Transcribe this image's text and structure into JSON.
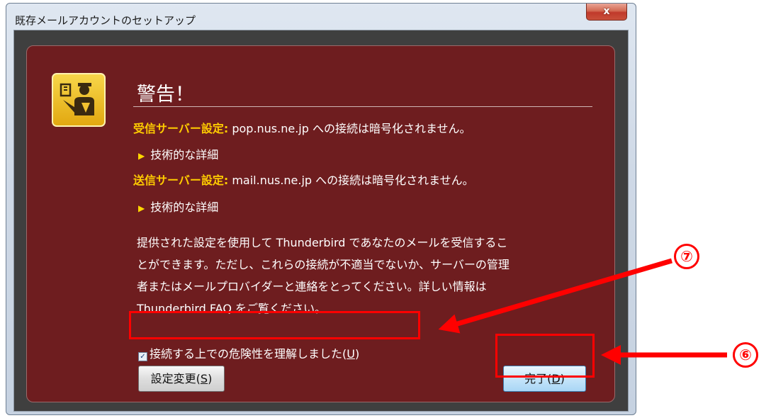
{
  "window": {
    "title": "既存メールアカウントのセットアップ",
    "close_label": "x"
  },
  "warning": {
    "heading": "警告！",
    "incoming_label": "受信サーバー設定:",
    "incoming_text": " pop.nus.ne.jp への接続は暗号化されません。",
    "details_1": "技術的な詳細",
    "outgoing_label": "送信サーバー設定:",
    "outgoing_text": " mail.nus.ne.jp への接続は暗号化されません。",
    "details_2": "技術的な詳細",
    "paragraph": [
      "提供された設定を使用して Thunderbird であなたのメールを受信するこ",
      "とができます。ただし、これらの接続が不適当でないか、サーバーの管理",
      "者またはメールプロバイダーと連絡をとってください。詳しい情報は",
      "Thunderbird FAQ をご覧ください。"
    ]
  },
  "checkbox": {
    "label": "接続する上での危険性を理解しました(",
    "accesskey": "U",
    "suffix": ")",
    "checked": true
  },
  "buttons": {
    "change_label": "設定変更(",
    "change_key": "S",
    "done_label": "完了(",
    "done_key": "D",
    "close_paren": ")"
  },
  "annotations": {
    "marker_7": "⑦",
    "marker_6": "⑥",
    "color": "#ff0000"
  }
}
